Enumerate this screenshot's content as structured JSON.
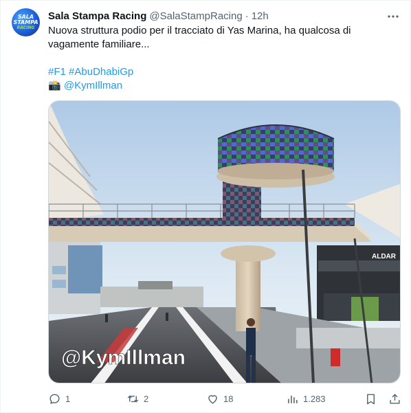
{
  "author": {
    "display_name": "Sala Stampa Racing",
    "handle": "@SalaStampRacing",
    "separator": "·",
    "time": "12h",
    "avatar_lines": [
      "SALA",
      "STAMPA",
      "RACING"
    ]
  },
  "tweet": {
    "text_line1": "Nuova struttura podio per il tracciato di Yas Marina, ha qualcosa di",
    "text_line2": "vagamente familiare...",
    "hashtag1": "#F1",
    "hashtag2": "#AbuDhabiGp",
    "camera_emoji": "📸",
    "credit_link": "@KymIllman"
  },
  "media": {
    "watermark": "@KymIllman",
    "sign_aldar": "ALDAR",
    "alt_description_shown": false
  },
  "actions": {
    "reply_count": "1",
    "retweet_count": "2",
    "like_count": "18",
    "views_count": "1.283"
  },
  "colors": {
    "accent": "#1d9bf0",
    "muted": "#536471",
    "text": "#0f1419"
  }
}
